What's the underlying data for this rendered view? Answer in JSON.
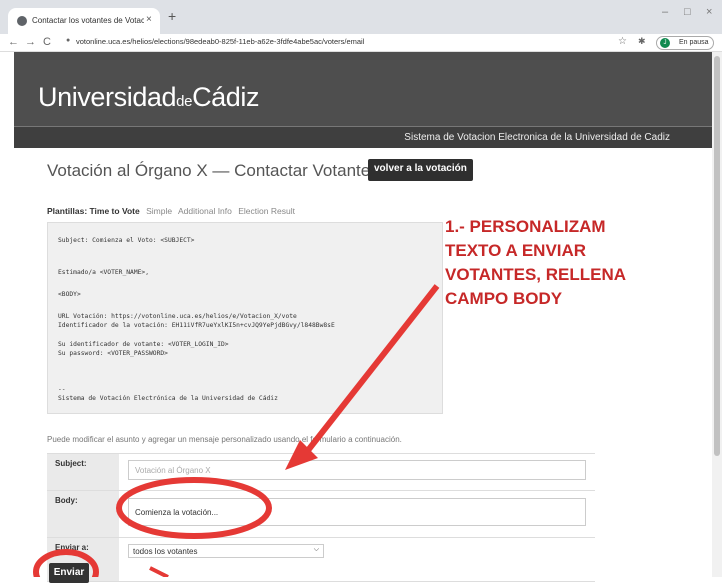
{
  "browser": {
    "tab_title": "Contactar los votantes de Votación",
    "tab_close": "×",
    "new_tab": "+",
    "url": "votonline.uca.es/helios/elections/98edeab0-825f-11eb-a62e-3fdfe4abe5ac/voters/email",
    "profile_initial": "J",
    "profile_status": "En pausa",
    "back": "←",
    "forward": "→",
    "reload": "C",
    "star": "☆",
    "menu": "⋮",
    "minimize": "–",
    "maximize": "□",
    "close": "×"
  },
  "header": {
    "logo_left": "Universidad",
    "logo_de": "de",
    "logo_right": "Cádiz",
    "system_title": "Sistema de Votacion Electronica de la Universidad de Cadiz"
  },
  "page": {
    "title": "Votación al Órgano X — Contactar Votantes",
    "back_button": "volver a la votación",
    "templates_label": "Plantillas: Time to Vote",
    "templates": [
      "Simple",
      "Additional Info",
      "Election Result"
    ],
    "helper_text": "Puede modificar el asunto y agregar un mensaje personalizado usando el formulario a continuación."
  },
  "preview": {
    "lines": [
      "Subject: Comienza el Voto: <SUBJECT>",
      "Estimado/a <VOTER_NAME>,",
      "<BODY>",
      "URL Votación:  https://votonline.uca.es/helios/e/Votacion_X/vote",
      "Identificador de la votación:  EH11iVfR7ueYxlKI5n+cvJQ9YePjdBGvy/l848Bw8sE",
      "Su identificador de votante: <VOTER_LOGIN_ID>",
      "Su password: <VOTER_PASSWORD>",
      "--",
      "Sistema de Votación Electrónica de la Universidad de Cádiz"
    ]
  },
  "form": {
    "subject_label": "Subject:",
    "subject_value": "Votación al Órgano X",
    "body_label": "Body:",
    "body_value": "Comienza la votación...",
    "send_to_label": "Enviar a:",
    "send_to_value": "todos los votantes",
    "submit_label": "Enviar"
  },
  "annotation": {
    "lines": [
      "1.-      PERSONALIZAM",
      "TEXTO   A   ENVIAR",
      "VOTANTES,  RELLENA",
      "CAMPO BODY"
    ],
    "color": "#c62828"
  }
}
